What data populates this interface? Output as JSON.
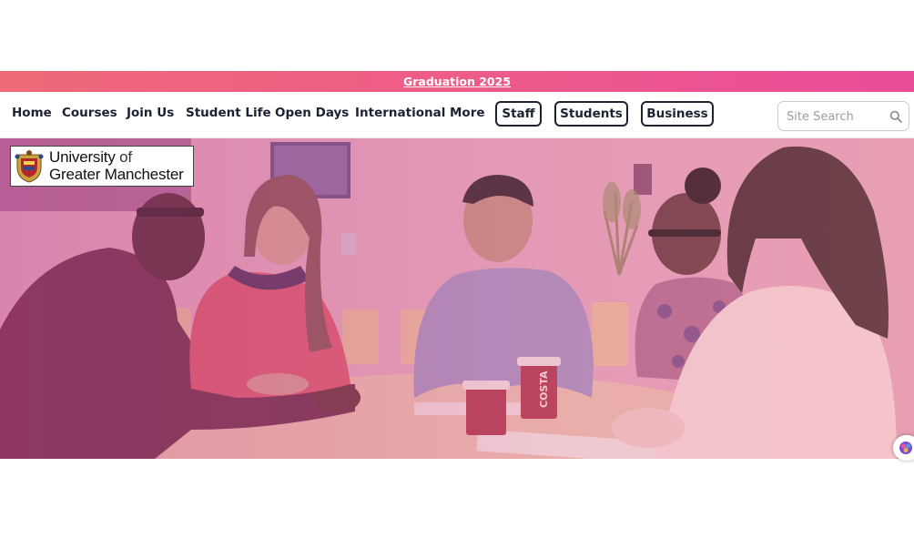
{
  "announcement": {
    "link_text": "Graduation 2025"
  },
  "nav": {
    "links": [
      "Home",
      "Courses",
      "Join Us",
      "Student Life",
      "Open Days",
      "International",
      "More"
    ],
    "pills": [
      "Staff",
      "Students",
      "Business"
    ]
  },
  "search": {
    "placeholder": "Site Search"
  },
  "logo": {
    "line1": "University",
    "line1_of": "of",
    "line2": "Greater Manchester"
  },
  "hero": {
    "cup_text": "COSTA",
    "image_subject": "students-meeting-photo"
  },
  "colors": {
    "announcement_gradient_start": "#ef6a78",
    "announcement_gradient_end": "#e94d9a",
    "nav_text": "#1d2233",
    "hero_tint": "#d47aa3"
  },
  "icons": [
    "search-icon",
    "crest-icon",
    "chatbot-icon"
  ]
}
